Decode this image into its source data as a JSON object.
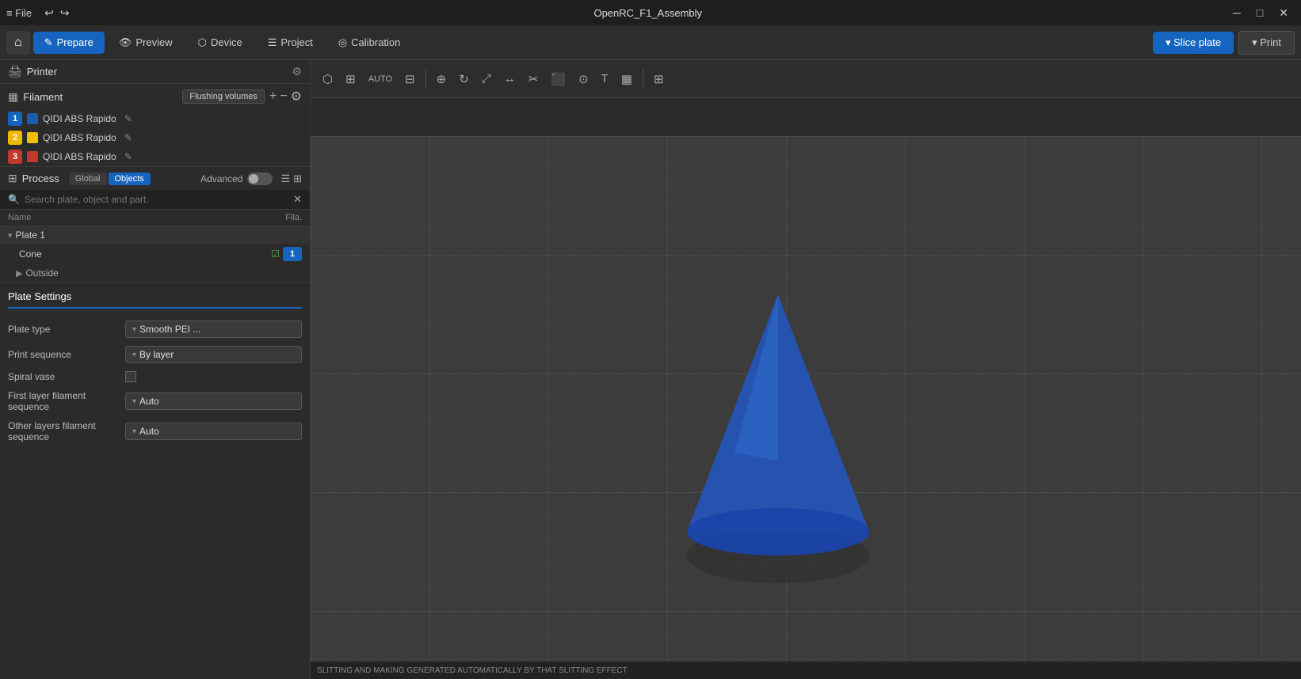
{
  "titlebar": {
    "title": "OpenRC_F1_Assembly",
    "file_menu": "File",
    "window_controls": {
      "minimize": "─",
      "maximize": "□",
      "close": "✕"
    }
  },
  "nav": {
    "home_icon": "⌂",
    "tabs": [
      {
        "id": "prepare",
        "label": "Prepare",
        "icon": "✎",
        "active": true
      },
      {
        "id": "preview",
        "label": "Preview",
        "icon": "👁",
        "active": false
      },
      {
        "id": "device",
        "label": "Device",
        "icon": "⬡",
        "active": false
      },
      {
        "id": "project",
        "label": "Project",
        "icon": "☰",
        "active": false
      },
      {
        "id": "calibration",
        "label": "Calibration",
        "icon": "◎",
        "active": false
      }
    ],
    "slice_label": "Slice plate",
    "print_label": "Print"
  },
  "toolbar": {
    "tools": [
      "⬡",
      "⊞",
      "⤢",
      "⊟",
      "⊠",
      "⊞",
      "|",
      "⊕",
      "⊙",
      "◈",
      "⊘",
      "⊡",
      "⊞",
      "⬛",
      "⬜",
      "⊞",
      "⊟",
      "⊠",
      "⊕",
      "⊙",
      "|",
      "⤢"
    ]
  },
  "printer": {
    "title": "Printer",
    "gear_icon": "⚙"
  },
  "filament": {
    "title": "Filament",
    "flushing_label": "Flushing volumes",
    "items": [
      {
        "num": "1",
        "color": "blue",
        "name": "QIDI ABS Rapido"
      },
      {
        "num": "2",
        "color": "yellow",
        "name": "QIDI ABS Rapido"
      },
      {
        "num": "3",
        "color": "red",
        "name": "QIDI ABS Rapido"
      }
    ]
  },
  "process": {
    "title": "Process",
    "global_label": "Global",
    "objects_label": "Objects",
    "advanced_label": "Advanced",
    "search_placeholder": "Search plate, object and part.",
    "list_headers": {
      "name": "Name",
      "filament": "Fila."
    },
    "items": [
      {
        "type": "plate",
        "name": "Plate 1",
        "expanded": true
      },
      {
        "type": "cone",
        "name": "Cone",
        "filament": "1"
      },
      {
        "type": "outside",
        "name": "Outside"
      }
    ]
  },
  "plate_settings": {
    "title": "Plate Settings",
    "settings": [
      {
        "label": "Plate type",
        "value": "Smooth PEI ...",
        "type": "dropdown"
      },
      {
        "label": "Print sequence",
        "value": "By layer",
        "type": "dropdown"
      },
      {
        "label": "Spiral vase",
        "value": "",
        "type": "checkbox"
      },
      {
        "label": "First layer filament sequence",
        "value": "Auto",
        "type": "dropdown"
      },
      {
        "label": "Other layers filament sequence",
        "value": "Auto",
        "type": "dropdown"
      }
    ]
  },
  "status": {
    "text": "SLITTING AND MAKING GENERATED AUTOMATICALLY BY THAT SLITTING EFFECT"
  }
}
